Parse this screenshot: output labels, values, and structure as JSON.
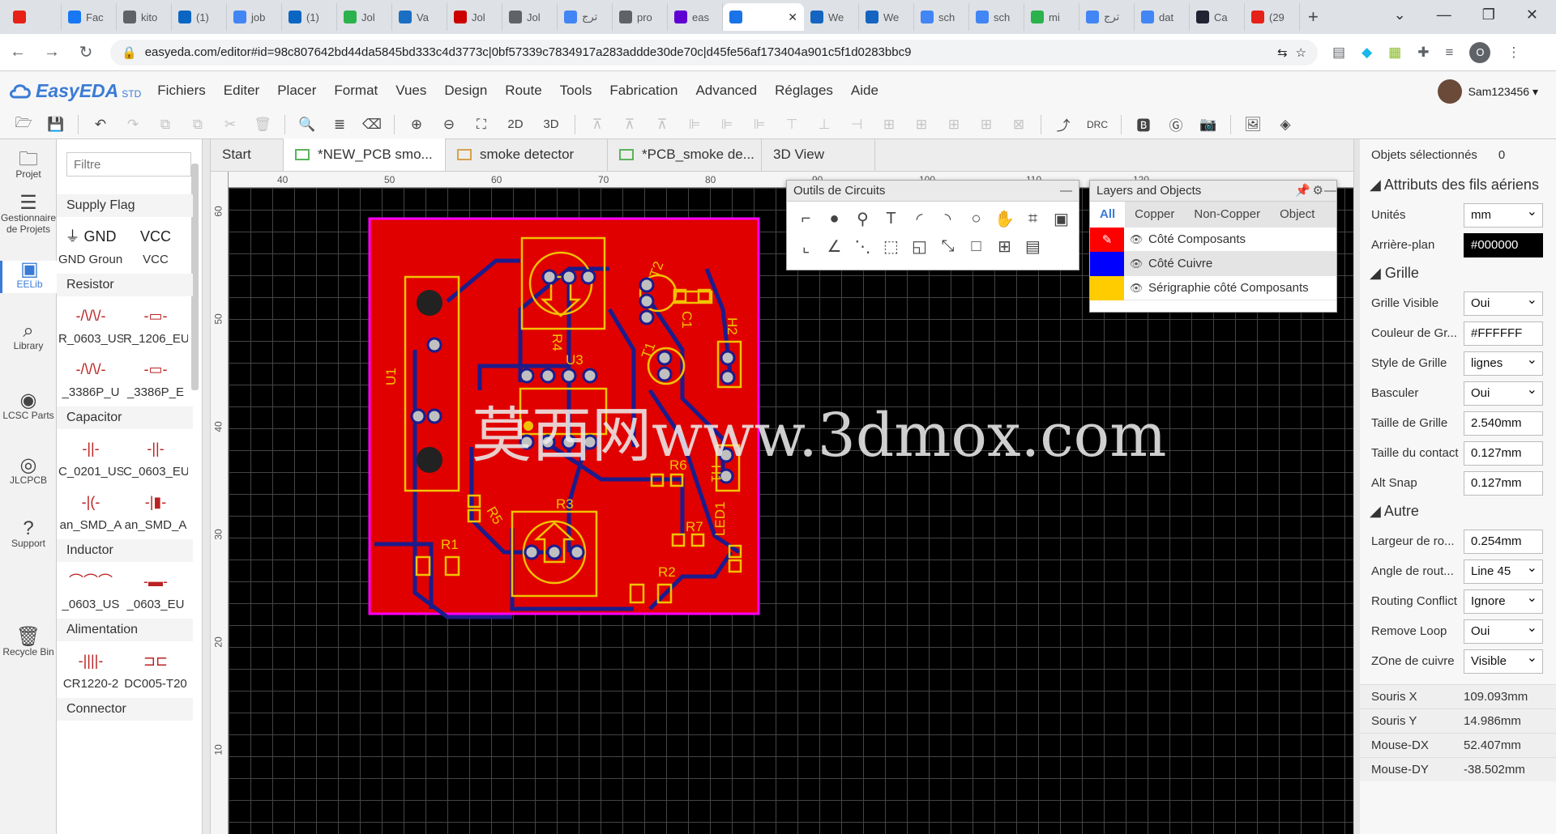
{
  "browser": {
    "tabs": [
      {
        "label": "",
        "color": "#e62117"
      },
      {
        "label": "Fac",
        "color": "#1877f2"
      },
      {
        "label": "kito",
        "color": "#5f6368"
      },
      {
        "label": "(1)",
        "color": "#0a66c2"
      },
      {
        "label": "job",
        "color": "#4285f4"
      },
      {
        "label": "(1)",
        "color": "#0a66c2"
      },
      {
        "label": "Jol",
        "color": "#2bb24c"
      },
      {
        "label": "Va",
        "color": "#1a6fc4"
      },
      {
        "label": "Jol",
        "color": "#c00"
      },
      {
        "label": "Jol",
        "color": "#5f6368"
      },
      {
        "label": "ترج",
        "color": "#4285f4"
      },
      {
        "label": "pro",
        "color": "#5f6368"
      },
      {
        "label": "eas",
        "color": "#5f01d1"
      },
      {
        "label": "",
        "color": "#1a73e8"
      },
      {
        "label": "We",
        "color": "#1565c0"
      },
      {
        "label": "We",
        "color": "#1565c0"
      },
      {
        "label": "sch",
        "color": "#4285f4"
      },
      {
        "label": "sch",
        "color": "#4285f4"
      },
      {
        "label": "mi",
        "color": "#2bb24c"
      },
      {
        "label": "ترج",
        "color": "#4285f4"
      },
      {
        "label": "dat",
        "color": "#4285f4"
      },
      {
        "label": "Ca",
        "color": "#223"
      },
      {
        "label": "(29",
        "color": "#e62117"
      }
    ],
    "new_tab": "+",
    "url": "easyeda.com/editor#id=98c807642bd44da5845bd333c4d3773c|0bf57339c7834917a283addde30de70c|d45fe56af173404a901c5f1d0283bbc9",
    "profile_letter": "O"
  },
  "app": {
    "logo": "EasyEDA",
    "logo_std": "STD",
    "menu": [
      "Fichiers",
      "Editer",
      "Placer",
      "Format",
      "Vues",
      "Design",
      "Route",
      "Tools",
      "Fabrication",
      "Advanced",
      "Réglages",
      "Aide"
    ],
    "user": "Sam123456 ▾"
  },
  "toolbar": {
    "two_d": "2D",
    "three_d": "3D",
    "drc": "DRC"
  },
  "left_nav": [
    {
      "label": "Projet",
      "icon": "🗀"
    },
    {
      "label": "Gestionnaire de Projets",
      "icon": "☰"
    },
    {
      "label": "EELib",
      "icon": "▣"
    },
    {
      "label": "Library",
      "icon": "⌕"
    },
    {
      "label": "LCSC Parts",
      "icon": "◉"
    },
    {
      "label": "JLCPCB",
      "icon": "◎"
    },
    {
      "label": "Support",
      "icon": "?"
    },
    {
      "label": "Recycle Bin",
      "icon": "🗑"
    }
  ],
  "library": {
    "filter_placeholder": "Filtre",
    "categories": [
      {
        "name": "Supply Flag",
        "parts": [
          {
            "label": "GND Ground",
            "sym": "⏚ GND"
          },
          {
            "label": "VCC",
            "sym": "VCC"
          }
        ]
      },
      {
        "name": "Resistor",
        "parts": [
          {
            "label": "R_0603_US",
            "sym": "-/\\/\\/-"
          },
          {
            "label": "R_1206_EU",
            "sym": "-▭-"
          },
          {
            "label": "_3386P_U",
            "sym": "-/\\/\\/-"
          },
          {
            "label": "_3386P_E",
            "sym": "-▭-"
          }
        ]
      },
      {
        "name": "Capacitor",
        "parts": [
          {
            "label": "C_0201_US",
            "sym": "-||-"
          },
          {
            "label": "C_0603_EU",
            "sym": "-||-"
          },
          {
            "label": "an_SMD_A",
            "sym": "-|(-"
          },
          {
            "label": "an_SMD_A",
            "sym": "-|▮-"
          }
        ]
      },
      {
        "name": "Inductor",
        "parts": [
          {
            "label": "_0603_US",
            "sym": "⌒⌒⌒"
          },
          {
            "label": "_0603_EU",
            "sym": "-▬-"
          }
        ]
      },
      {
        "name": "Alimentation",
        "parts": [
          {
            "label": "CR1220-2",
            "sym": "-||||-"
          },
          {
            "label": "DC005-T20",
            "sym": "⊐⊏"
          }
        ]
      },
      {
        "name": "Connector",
        "parts": []
      }
    ]
  },
  "doc_tabs": [
    {
      "label": "Start",
      "type": "none",
      "active": false
    },
    {
      "label": "*NEW_PCB smo...",
      "type": "pcb",
      "active": true
    },
    {
      "label": "smoke detector",
      "type": "folder",
      "active": false
    },
    {
      "label": "*PCB_smoke de...",
      "type": "pcb",
      "active": false
    },
    {
      "label": "3D View",
      "type": "none",
      "active": false
    }
  ],
  "ruler": {
    "h": [
      "40",
      "50",
      "60",
      "70",
      "80",
      "90",
      "100",
      "110",
      "120"
    ],
    "v": [
      "60",
      "50",
      "40",
      "30",
      "20",
      "10"
    ]
  },
  "pcb": {
    "labels": [
      "U1",
      "R4",
      "U3",
      "T2",
      "C1",
      "T1",
      "H2",
      "R5",
      "R3",
      "R6",
      "H1",
      "R7",
      "LED1",
      "R1",
      "R2"
    ],
    "colors": {
      "board": "#e00000",
      "trace": "#1c1c8c",
      "silk": "#f2c200",
      "pad": "#c0c0c0",
      "outline": "#ff00ff"
    }
  },
  "watermark": "莫西网www.3dmox.com",
  "circuit_tools": {
    "title": "Outils de Circuits",
    "tools": [
      "⌐",
      "●",
      "⚲",
      "T",
      "◜",
      "◝",
      "○",
      "✋",
      "⌗",
      "▣",
      "⌞",
      "∠",
      "⋱",
      "⬚",
      "◱",
      "⤡",
      "□",
      "⊞",
      "▤"
    ]
  },
  "layers_panel": {
    "title": "Layers and Objects",
    "tabs": [
      "All",
      "Copper",
      "Non-Copper",
      "Object"
    ],
    "layers": [
      {
        "name": "Côté Composants",
        "color": "#ff0000",
        "selected": false,
        "active": true
      },
      {
        "name": "Côté Cuivre",
        "color": "#0000ff",
        "selected": true,
        "active": false
      },
      {
        "name": "Sérigraphie côté Composants",
        "color": "#ffcc00",
        "selected": false,
        "active": false
      }
    ]
  },
  "properties": {
    "selected_label": "Objets sélectionnés",
    "selected_count": "0",
    "section_wires": "Attributs des fils aériens",
    "units_label": "Unités",
    "units": "mm",
    "bg_label": "Arrière-plan",
    "bg": "#000000",
    "section_grid": "Grille",
    "grid_visible_label": "Grille Visible",
    "grid_visible": "Oui",
    "grid_color_label": "Couleur de Gr...",
    "grid_color": "#FFFFFF",
    "grid_style_label": "Style de Grille",
    "grid_style": "lignes",
    "toggle_label": "Basculer",
    "toggle": "Oui",
    "grid_size_label": "Taille de Grille",
    "grid_size": "2.540mm",
    "snap_size_label": "Taille du contact",
    "snap_size": "0.127mm",
    "alt_snap_label": "Alt Snap",
    "alt_snap": "0.127mm",
    "section_other": "Autre",
    "route_width_label": "Largeur de ro...",
    "route_width": "0.254mm",
    "route_angle_label": "Angle de rout...",
    "route_angle": "Line 45",
    "routing_conflict_label": "Routing Conflict",
    "routing_conflict": "Ignore",
    "remove_loop_label": "Remove Loop",
    "remove_loop": "Oui",
    "copper_zone_label": "ZOne de cuivre",
    "copper_zone": "Visible",
    "mouse_x_label": "Souris X",
    "mouse_x": "109.093mm",
    "mouse_y_label": "Souris Y",
    "mouse_y": "14.986mm",
    "mouse_dx_label": "Mouse-DX",
    "mouse_dx": "52.407mm",
    "mouse_dy_label": "Mouse-DY",
    "mouse_dy": "-38.502mm"
  }
}
